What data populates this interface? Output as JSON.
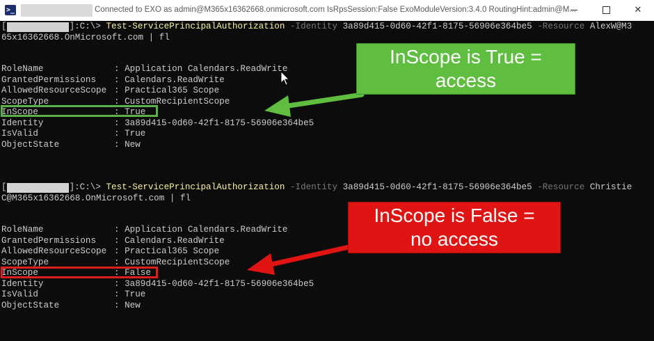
{
  "window": {
    "title": "Connected to EXO as admin@M365x16362668.onmicrosoft.com IsRpsSession:False ExoModuleVersion:3.4.0 RoutingHint:admin@M...",
    "icon": "powershell-icon",
    "buttons": {
      "minimize": "minimize-icon",
      "maximize": "maximize-icon",
      "close": "✕"
    }
  },
  "colors": {
    "console_bg": "#0c0c0c",
    "output_text": "#cccccc",
    "command_text": "#f9f1a5",
    "parameter_text": "#767676",
    "green_highlight": "#5bb04a",
    "green_callout": "#5fbe40",
    "red_highlight": "#e01e1e",
    "red_callout": "#e11414"
  },
  "blocks": [
    {
      "prompt_open": "[",
      "prompt_path": "]:C:\\> ",
      "command": "Test-ServicePrincipalAuthorization",
      "param_identity": "-Identity",
      "identity_value": "3a89d415-0d60-42f1-8175-56906e364be5",
      "param_resource": "-Resource",
      "resource_value_start": "AlexW@M3",
      "continuation": "65x16362668.OnMicrosoft.com | fl",
      "output": [
        {
          "name": "RoleName",
          "value": "Application Calendars.ReadWrite"
        },
        {
          "name": "GrantedPermissions",
          "value": "Calendars.ReadWrite"
        },
        {
          "name": "AllowedResourceScope",
          "value": "Practical365 Scope"
        },
        {
          "name": "ScopeType",
          "value": "CustomRecipientScope"
        },
        {
          "name": "InScope",
          "value": "True"
        },
        {
          "name": "Identity",
          "value": "3a89d415-0d60-42f1-8175-56906e364be5"
        },
        {
          "name": "IsValid",
          "value": "True"
        },
        {
          "name": "ObjectState",
          "value": "New"
        }
      ],
      "callout": "InScope is True =\naccess"
    },
    {
      "prompt_open": "[",
      "prompt_path": "]:C:\\> ",
      "command": "Test-ServicePrincipalAuthorization",
      "param_identity": "-Identity",
      "identity_value": "3a89d415-0d60-42f1-8175-56906e364be5",
      "param_resource": "-Resource",
      "resource_value_start": "Christie",
      "continuation": "C@M365x16362668.OnMicrosoft.com | fl",
      "output": [
        {
          "name": "RoleName",
          "value": "Application Calendars.ReadWrite"
        },
        {
          "name": "GrantedPermissions",
          "value": "Calendars.ReadWrite"
        },
        {
          "name": "AllowedResourceScope",
          "value": "Practical365 Scope"
        },
        {
          "name": "ScopeType",
          "value": "CustomRecipientScope"
        },
        {
          "name": "InScope",
          "value": "False"
        },
        {
          "name": "Identity",
          "value": "3a89d415-0d60-42f1-8175-56906e364be5"
        },
        {
          "name": "IsValid",
          "value": "True"
        },
        {
          "name": "ObjectState",
          "value": "New"
        }
      ],
      "callout": "InScope is False =\nno access"
    }
  ]
}
